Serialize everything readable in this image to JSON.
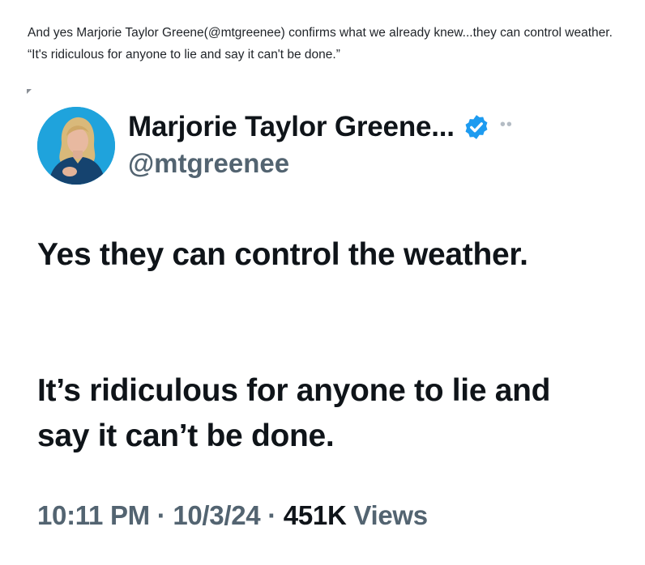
{
  "post": {
    "caption": "And yes Marjorie Taylor Greene(@mtgreenee) confirms what we already knew...they can control weather. “It's ridiculous for anyone to lie and say it can't be done.”"
  },
  "tweet": {
    "display_name": "Marjorie Taylor Greene...",
    "handle": "@mtgreenee",
    "more_label": "••",
    "paragraphs": [
      "Yes they can control the weather.",
      "It’s ridiculous for anyone to lie and say it can’t be done."
    ],
    "time": "10:11 PM",
    "separator": "·",
    "date": "10/3/24",
    "views_count": "451K",
    "views_label": "Views"
  },
  "colors": {
    "verified_badge": "#1d9bf0",
    "secondary_text": "#536471",
    "primary_text": "#0f1419"
  }
}
